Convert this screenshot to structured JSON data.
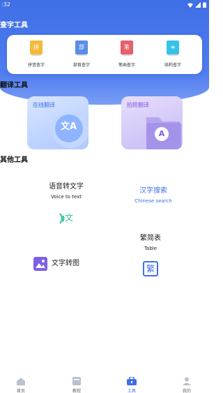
{
  "status_bar": {
    "time": ":32"
  },
  "sections": {
    "char_tools": "查字工具",
    "translate_tools": "翻译工具",
    "other_tools": "其他工具"
  },
  "char_tools": [
    {
      "icon_char": "拼",
      "label": "拼音查字",
      "color": "#f5b93a"
    },
    {
      "icon_char": "部",
      "label": "部首查字",
      "color": "#5c8ee8"
    },
    {
      "icon_char": "笔",
      "label": "笔画查字",
      "color": "#e8606a"
    },
    {
      "icon_char": "≡",
      "label": "结构查字",
      "color": "#35c3e8"
    }
  ],
  "translate": {
    "online": {
      "label": "在线翻译",
      "icon_text": "文A"
    },
    "photo": {
      "label": "拍照翻译",
      "icon_text": "A"
    }
  },
  "other": {
    "voice": {
      "title": "语音转文字",
      "subtitle": "Voice to text",
      "icon_text": "文"
    },
    "chinese_search": {
      "title": "汉字搜索",
      "subtitle": "Chinese search"
    },
    "trad_simp": {
      "title": "繁简表",
      "subtitle": "Table",
      "icon_text": "繁"
    },
    "text_to_image": {
      "title": "文字转图"
    }
  },
  "nav": [
    {
      "label": "首页",
      "icon": "home-icon"
    },
    {
      "label": "教程",
      "icon": "book-icon"
    },
    {
      "label": "工具",
      "icon": "toolbox-icon"
    },
    {
      "label": "我的",
      "icon": "user-icon"
    }
  ],
  "colors": {
    "accent": "#3f6fe6",
    "active_nav": "#3f6fe6"
  }
}
